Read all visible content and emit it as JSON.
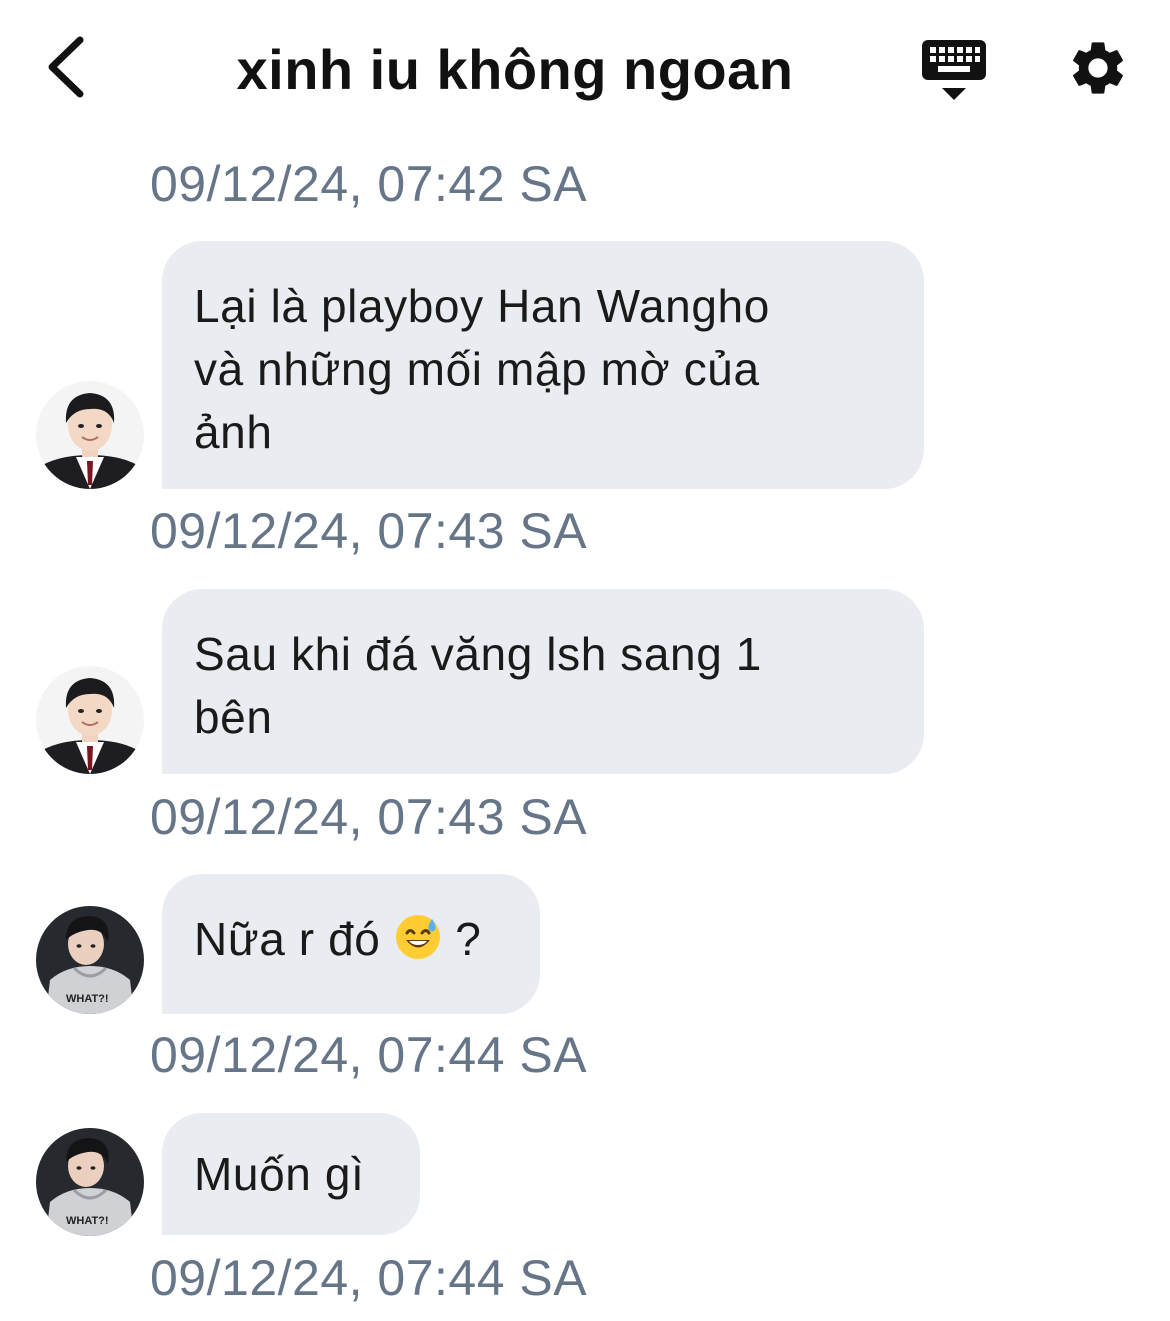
{
  "header": {
    "title": "xinh iu không ngoan",
    "back_icon": "chevron-left-icon",
    "keyboard_icon": "keyboard-icon",
    "settings_icon": "gear-icon"
  },
  "colors": {
    "bubble_bg": "#e9ecf0",
    "timestamp": "#667688",
    "text": "#1a1a1a"
  },
  "messages": [
    {
      "timestamp": "09/12/24, 07:42 SA",
      "sender": "avatar-boy-uniform",
      "text": "Lại là playboy Han Wangho\nvà những mối mập mờ của\nảnh"
    },
    {
      "timestamp": "09/12/24, 07:43 SA",
      "sender": "avatar-boy-uniform",
      "text": "Sau khi đá văng lsh sang 1\nbên"
    },
    {
      "timestamp": "09/12/24, 07:43 SA",
      "sender": "avatar-boy-hoodie",
      "text_before": "Nữa r đó ",
      "emoji": "sweat-smile-emoji",
      "text_after": " ?"
    },
    {
      "timestamp": "09/12/24, 07:44 SA",
      "sender": "avatar-boy-hoodie",
      "text": "Muốn gì"
    }
  ],
  "last_timestamp": "09/12/24, 07:44 SA"
}
